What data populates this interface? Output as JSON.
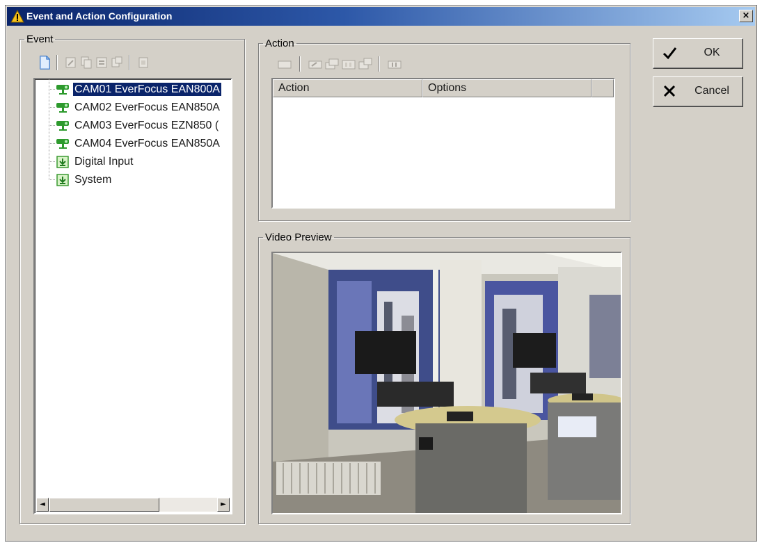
{
  "window": {
    "title": "Event and Action Configuration",
    "close_glyph": "×",
    "title_icon": "warning-icon"
  },
  "event": {
    "legend": "Event",
    "toolbar_icons": [
      "new-event-icon",
      "edit-icon",
      "copy-icon",
      "paste-icon",
      "duplicate-icon",
      "delete-icon"
    ],
    "tree": [
      {
        "label": "CAM01 EverFocus EAN800A",
        "icon": "camera-icon",
        "selected": true
      },
      {
        "label": "CAM02 EverFocus EAN850A",
        "icon": "camera-icon",
        "selected": false
      },
      {
        "label": "CAM03 EverFocus EZN850 (",
        "icon": "camera-icon",
        "selected": false
      },
      {
        "label": "CAM04 EverFocus EAN850A",
        "icon": "camera-icon",
        "selected": false
      },
      {
        "label": "Digital Input",
        "icon": "input-icon",
        "selected": false
      },
      {
        "label": "System",
        "icon": "input-icon",
        "selected": false
      }
    ],
    "scroll_left": "◄",
    "scroll_right": "►"
  },
  "action": {
    "legend": "Action",
    "toolbar_icons": [
      "new-action-icon",
      "edit-action-icon",
      "copy-action-icon",
      "paste-action-icon",
      "duplicate-action-icon",
      "delete-action-icon"
    ],
    "columns": [
      "Action",
      "Options"
    ],
    "rows": []
  },
  "preview": {
    "legend": "Video Preview"
  },
  "buttons": {
    "ok_label": "OK",
    "cancel_label": "Cancel"
  },
  "colors": {
    "dialog_bg": "#d4d0c8",
    "title_start": "#0a246a",
    "title_end": "#a6caf0",
    "selection": "#0a246a",
    "camera_icon": "#2d9a2d"
  }
}
